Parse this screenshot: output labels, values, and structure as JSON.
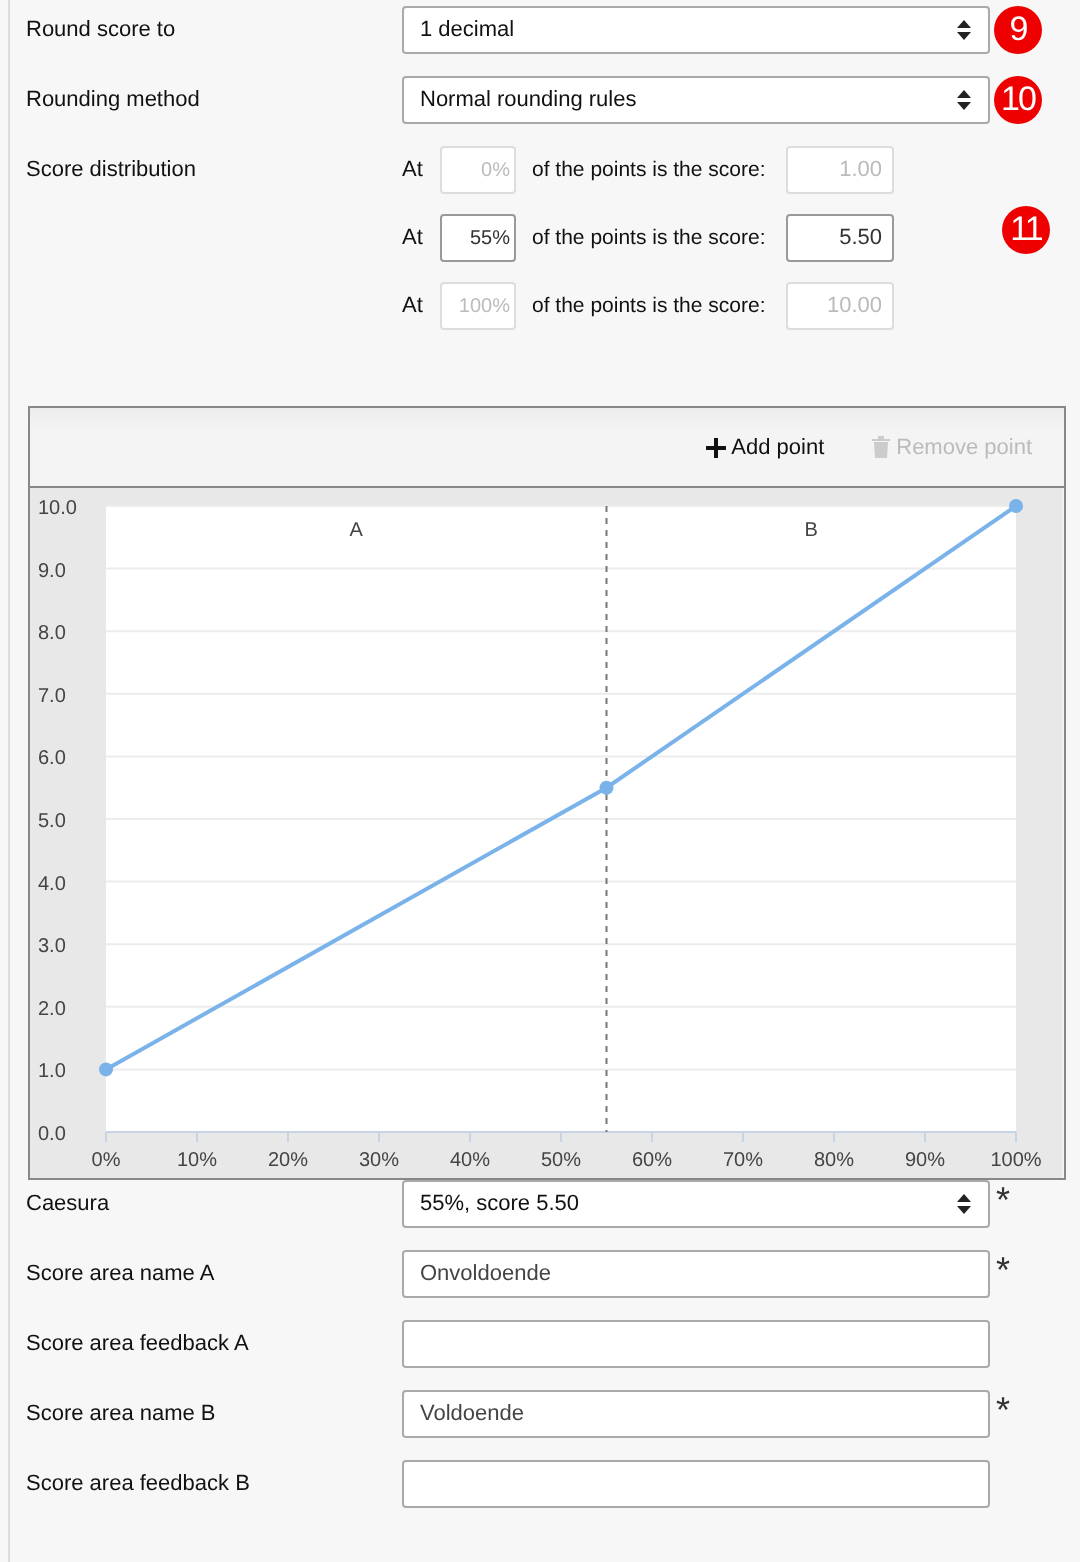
{
  "settings": [
    {
      "label": "Round score to",
      "kind": "select",
      "value": "1 decimal",
      "badge": "9"
    },
    {
      "label": "Rounding method",
      "kind": "select",
      "value": "Normal rounding rules",
      "badge": "10"
    }
  ],
  "distribution": {
    "label": "Score distribution",
    "badge": "11",
    "rows": [
      {
        "prefix": "At",
        "percent": "0%",
        "middle": "of the points is the score:",
        "score": "1.00",
        "disabled": true
      },
      {
        "prefix": "At",
        "percent": "55%",
        "middle": "of the points is the score:",
        "score": "5.50",
        "disabled": false
      },
      {
        "prefix": "At",
        "percent": "100%",
        "middle": "of the points is the score:",
        "score": "10.00",
        "disabled": true
      }
    ]
  },
  "chart_panel": {
    "toolbar": [
      {
        "kind": "add",
        "label": "Add point",
        "disabled": false
      },
      {
        "kind": "remove",
        "label": "Remove point",
        "disabled": true
      }
    ],
    "chart_data": {
      "type": "line",
      "x": [
        0,
        55,
        100
      ],
      "series": [
        {
          "color": "#7ab3ea",
          "marker": "circle",
          "values": [
            1,
            5.5,
            10
          ]
        }
      ],
      "grid": true,
      "xlim": [
        0,
        100
      ],
      "ylim": [
        0,
        10
      ],
      "xticks": [
        {
          "value": 0,
          "label": "0%"
        },
        {
          "value": 10,
          "label": "10%"
        },
        {
          "value": 20,
          "label": "20%"
        },
        {
          "value": 30,
          "label": "30%"
        },
        {
          "value": 40,
          "label": "40%"
        },
        {
          "value": 50,
          "label": "50%"
        },
        {
          "value": 60,
          "label": "60%"
        },
        {
          "value": 70,
          "label": "70%"
        },
        {
          "value": 80,
          "label": "80%"
        },
        {
          "value": 90,
          "label": "90%"
        },
        {
          "value": 100,
          "label": "100%"
        }
      ],
      "yticks": [
        {
          "value": 0,
          "label": "0.0"
        },
        {
          "value": 1,
          "label": "1.0"
        },
        {
          "value": 2,
          "label": "2.0"
        },
        {
          "value": 3,
          "label": "3.0"
        },
        {
          "value": 4,
          "label": "4.0"
        },
        {
          "value": 5,
          "label": "5.0"
        },
        {
          "value": 6,
          "label": "6.0"
        },
        {
          "value": 7,
          "label": "7.0"
        },
        {
          "value": 8,
          "label": "8.0"
        },
        {
          "value": 9,
          "label": "9.0"
        },
        {
          "value": 10,
          "label": "10.0"
        }
      ],
      "ref_lines": [
        {
          "axis": "x",
          "value": 55
        }
      ],
      "annotations": [
        "A",
        "B"
      ]
    }
  },
  "fields": [
    {
      "label": "Caesura",
      "kind": "select",
      "value": "55%, score 5.50",
      "marker": "*"
    },
    {
      "label": "Score area name A",
      "kind": "text",
      "value": "Onvoldoende",
      "marker": "*"
    },
    {
      "label": "Score area feedback A",
      "kind": "text"
    },
    {
      "label": "Score area name B",
      "kind": "text",
      "value": "Voldoende",
      "marker": "*"
    },
    {
      "label": "Score area feedback B",
      "kind": "text"
    }
  ]
}
